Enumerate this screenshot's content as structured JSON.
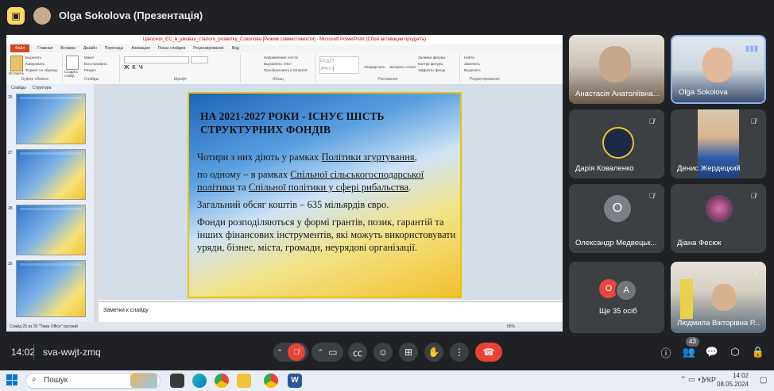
{
  "meeting": {
    "presenter_name": "Olga Sokolova (Презентація)",
    "time": "14:02",
    "code": "sva-wwjt-zmq",
    "participant_count": "43"
  },
  "ppt": {
    "window_title": "Ціноскоп_ЄС_в_умовах_сталого_розвитку_Соколова [Режим совместимости] - Microsoft PowerPoint (Сбой активации продукта)",
    "tabs": [
      "Файл",
      "Главная",
      "Вставка",
      "Дизайн",
      "Переходы",
      "Анимация",
      "Показ слайдов",
      "Рецензирование",
      "Вид"
    ],
    "ribbon_groups": [
      "Буфер обмена",
      "Слайды",
      "Шрифт",
      "Абзац",
      "Рисование",
      "Редактирование"
    ],
    "ribbon_items": {
      "paste": "Вставить",
      "create_slide": "Создать слайд",
      "layout": "Макет",
      "reset": "Восстановить",
      "section": "Раздел",
      "cut": "Вырезать",
      "copy": "Копировать",
      "format": "Формат по образцу",
      "direction": "Направление текста",
      "align": "Выровнять текст",
      "smartart": "Преобразовать в SmartArt",
      "arrange": "Упорядочить",
      "styles": "Экспресс-стили",
      "fill": "Заливка фигуры",
      "outline": "Контур фигуры",
      "effects": "Эффекты фигур",
      "find": "Найти",
      "replace": "Заменить",
      "select": "Выделить"
    },
    "panel_tabs": [
      "Слайды",
      "Структура"
    ],
    "thumb_numbers": [
      "26",
      "27",
      "28",
      "29"
    ],
    "notes_placeholder": "Заметки к слайду",
    "status": "Слайд 25 из 35   \"Тема Office\"   русский",
    "zoom": "65%"
  },
  "slide": {
    "heading": "НА 2021-2027 РОКИ - ІСНУЄ ШІСТЬ СТРУКТУРНИХ ФОНДІВ",
    "p1_a": "Чотири з них діють у рамках ",
    "p1_link": "Політики згуртування",
    "p1_b": ",",
    "p2_a": "по одному – в рамках ",
    "p2_link1": "Спільної сільськогосподарської політики",
    "p2_b": " та ",
    "p2_link2": "Спільної політики у сфері рибальства",
    "p2_c": ".",
    "p3": "Загальний обсяг коштів – 635 мільярдів євро.",
    "p4": "Фонди розподіляються у формі грантів, позик, гарантій та інших фінансових інструментів, які можуть використовувати уряди, бізнес, міста, громади, неурядові організації."
  },
  "participants": [
    {
      "name": "Анастасія Анатоліївна...",
      "muted": true
    },
    {
      "name": "Olga Sokolova",
      "muted": false,
      "speaking": true
    },
    {
      "name": "Дарія Коваленко",
      "muted": true
    },
    {
      "name": "Денис Жердецкий",
      "muted": true
    },
    {
      "name": "Олександр Медвецьк...",
      "muted": true,
      "initial": "О",
      "color": "#7b8088"
    },
    {
      "name": "Діана Фесюк",
      "muted": true
    },
    {
      "name": "Ще 35 осіб",
      "initials": [
        "О",
        "А"
      ],
      "colors": [
        "#e8453c",
        "#757575"
      ]
    },
    {
      "name": "Людмила Вікторівна Р...",
      "muted": true
    }
  ],
  "taskbar": {
    "search_placeholder": "Пошук",
    "lang": "УКР",
    "clock_time": "14:02",
    "clock_date": "08.05.2024"
  },
  "colors": {
    "accent": "#8ab4f8",
    "end_call": "#ea4335",
    "mic_off": "#ea4335"
  }
}
